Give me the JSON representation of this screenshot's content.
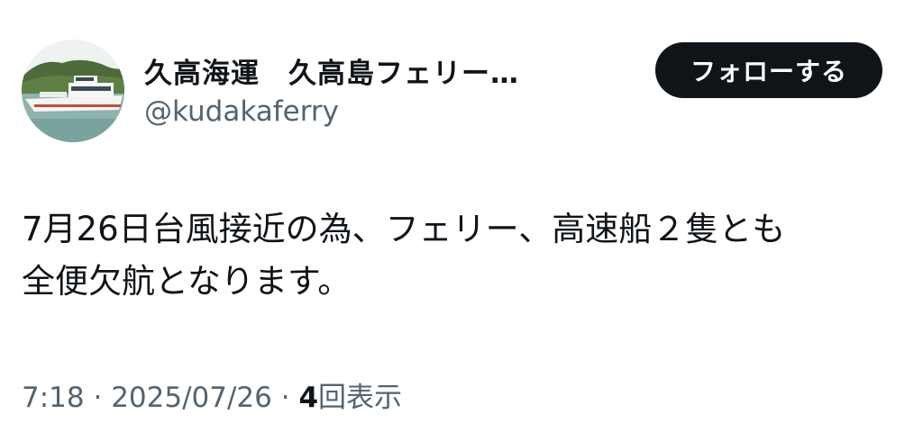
{
  "author": {
    "display_name": "久高海運　久高島フェリー…",
    "handle": "@kudakaferry",
    "avatar_icon": "ferry-photo-avatar"
  },
  "follow_button": {
    "label": "フォローする"
  },
  "post": {
    "text_line1": "7月26日台風接近の為、フェリー、高速船２隻とも",
    "text_line2": "全便欠航となります。"
  },
  "meta": {
    "time": "7:18",
    "separator1": " · ",
    "date": "2025/07/26",
    "separator2": " · ",
    "views_count": "4",
    "views_label": "回表示"
  },
  "colors": {
    "text": "#0f1419",
    "secondary": "#536471",
    "button_bg": "#0f1419",
    "button_text": "#ffffff"
  }
}
